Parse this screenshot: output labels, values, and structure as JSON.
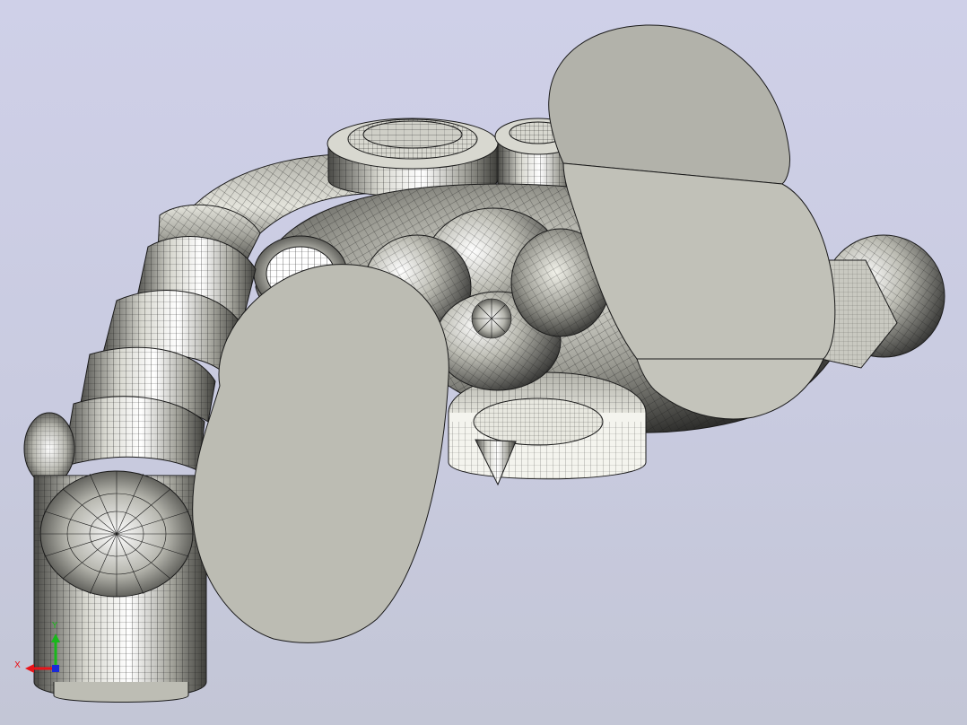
{
  "viewport": {
    "background_top": "#cfd0e8",
    "background_bottom": "#c3c6d6"
  },
  "model": {
    "face_fill": "#b9b9b0",
    "shade_light": "#ffffff",
    "shade_dark": "#3a3a38",
    "edge_color": "#1a1a1a"
  },
  "axis_triad": {
    "x_label": "X",
    "y_label": "Y",
    "z_label": "Z",
    "x_color": "#e8141a",
    "y_color": "#18b81a",
    "z_color": "#1a2ad8"
  }
}
